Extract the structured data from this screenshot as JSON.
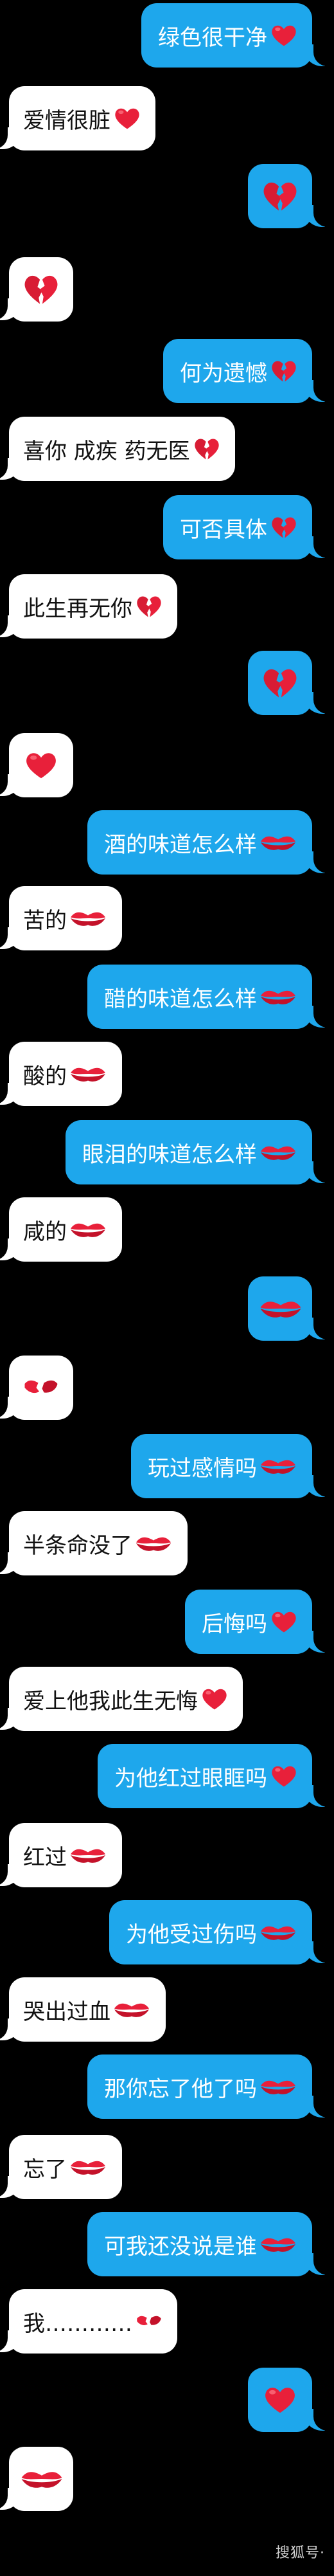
{
  "messages": [
    {
      "side": "sent",
      "text": "绿色很干净",
      "emoji": "red-heart"
    },
    {
      "side": "recv",
      "text": "爱情很脏",
      "emoji": "red-heart"
    },
    {
      "side": "sent",
      "text": "",
      "emoji": "broken-heart"
    },
    {
      "side": "recv",
      "text": "",
      "emoji": "broken-heart"
    },
    {
      "side": "sent",
      "text": "何为遗憾",
      "emoji": "broken-heart"
    },
    {
      "side": "recv",
      "text": "喜你 成疾 药无医",
      "emoji": "broken-heart"
    },
    {
      "side": "sent",
      "text": "可否具体",
      "emoji": "broken-heart"
    },
    {
      "side": "recv",
      "text": "此生再无你",
      "emoji": "broken-heart"
    },
    {
      "side": "sent",
      "text": "",
      "emoji": "broken-heart"
    },
    {
      "side": "recv",
      "text": "",
      "emoji": "red-heart"
    },
    {
      "side": "sent",
      "text": "酒的味道怎么样",
      "emoji": "lips"
    },
    {
      "side": "recv",
      "text": "苦的",
      "emoji": "lips"
    },
    {
      "side": "sent",
      "text": "醋的味道怎么样",
      "emoji": "lips"
    },
    {
      "side": "recv",
      "text": "酸的",
      "emoji": "lips"
    },
    {
      "side": "sent",
      "text": "眼泪的味道怎么样",
      "emoji": "lips"
    },
    {
      "side": "recv",
      "text": "咸的",
      "emoji": "lips"
    },
    {
      "side": "sent",
      "text": "",
      "emoji": "lips"
    },
    {
      "side": "recv",
      "text": "",
      "emoji": "broken-lips"
    },
    {
      "side": "sent",
      "text": "玩过感情吗",
      "emoji": "lips"
    },
    {
      "side": "recv",
      "text": "半条命没了",
      "emoji": "lips"
    },
    {
      "side": "sent",
      "text": "后悔吗",
      "emoji": "red-heart"
    },
    {
      "side": "recv",
      "text": "爱上他我此生无悔",
      "emoji": "red-heart"
    },
    {
      "side": "sent",
      "text": "为他红过眼眶吗",
      "emoji": "red-heart"
    },
    {
      "side": "recv",
      "text": "红过",
      "emoji": "lips"
    },
    {
      "side": "sent",
      "text": "为他受过伤吗",
      "emoji": "lips"
    },
    {
      "side": "recv",
      "text": "哭出过血",
      "emoji": "lips"
    },
    {
      "side": "sent",
      "text": "那你忘了他了吗",
      "emoji": "lips"
    },
    {
      "side": "recv",
      "text": "忘了",
      "emoji": "lips"
    },
    {
      "side": "sent",
      "text": "可我还没说是谁",
      "emoji": "lips"
    },
    {
      "side": "recv",
      "text": "我…………",
      "emoji": "broken-lips"
    },
    {
      "side": "sent",
      "text": "",
      "emoji": "red-heart"
    },
    {
      "side": "recv",
      "text": "",
      "emoji": "lips"
    }
  ],
  "watermark": "搜狐号·"
}
